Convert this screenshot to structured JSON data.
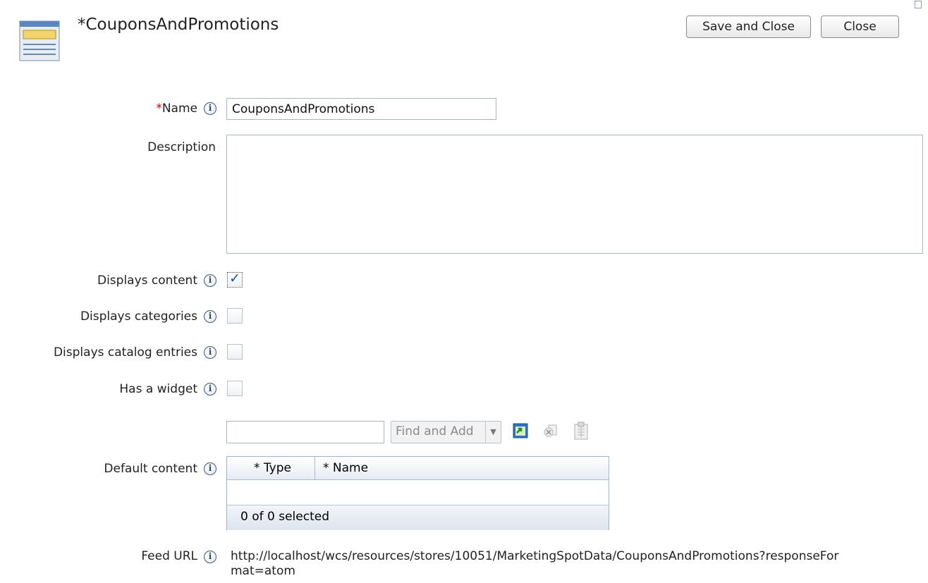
{
  "header": {
    "title": "*CouponsAndPromotions",
    "icon": "marketing-spot-icon",
    "save_close_label": "Save and Close",
    "close_label": "Close"
  },
  "form": {
    "name": {
      "required_mark": "*",
      "label": "Name",
      "value": "CouponsAndPromotions"
    },
    "description": {
      "label": "Description",
      "value": ""
    },
    "displays_content": {
      "label": "Displays content",
      "checked": true
    },
    "displays_categories": {
      "label": "Displays categories",
      "checked": false
    },
    "displays_catalog_entries": {
      "label": "Displays catalog entries",
      "checked": false
    },
    "has_widget": {
      "label": "Has a widget",
      "checked": false
    },
    "default_content": {
      "label": "Default content",
      "find_input_value": "",
      "find_add_label": "Find and Add",
      "grid": {
        "columns": [
          "* Type",
          "* Name"
        ],
        "rows": [],
        "selected_summary": "0 of 0 selected"
      }
    },
    "feed_url": {
      "label": "Feed URL",
      "line1": "http://localhost/wcs/resources/stores/10051/MarketingSpotData/CouponsAndPromotions?responseFor",
      "line2": "mat=atom"
    }
  },
  "info_glyph": "i",
  "colors": {
    "required": "#dd0000",
    "checkbox_mark": "#1d4e9b",
    "grid_border": "#9fb5cc"
  }
}
